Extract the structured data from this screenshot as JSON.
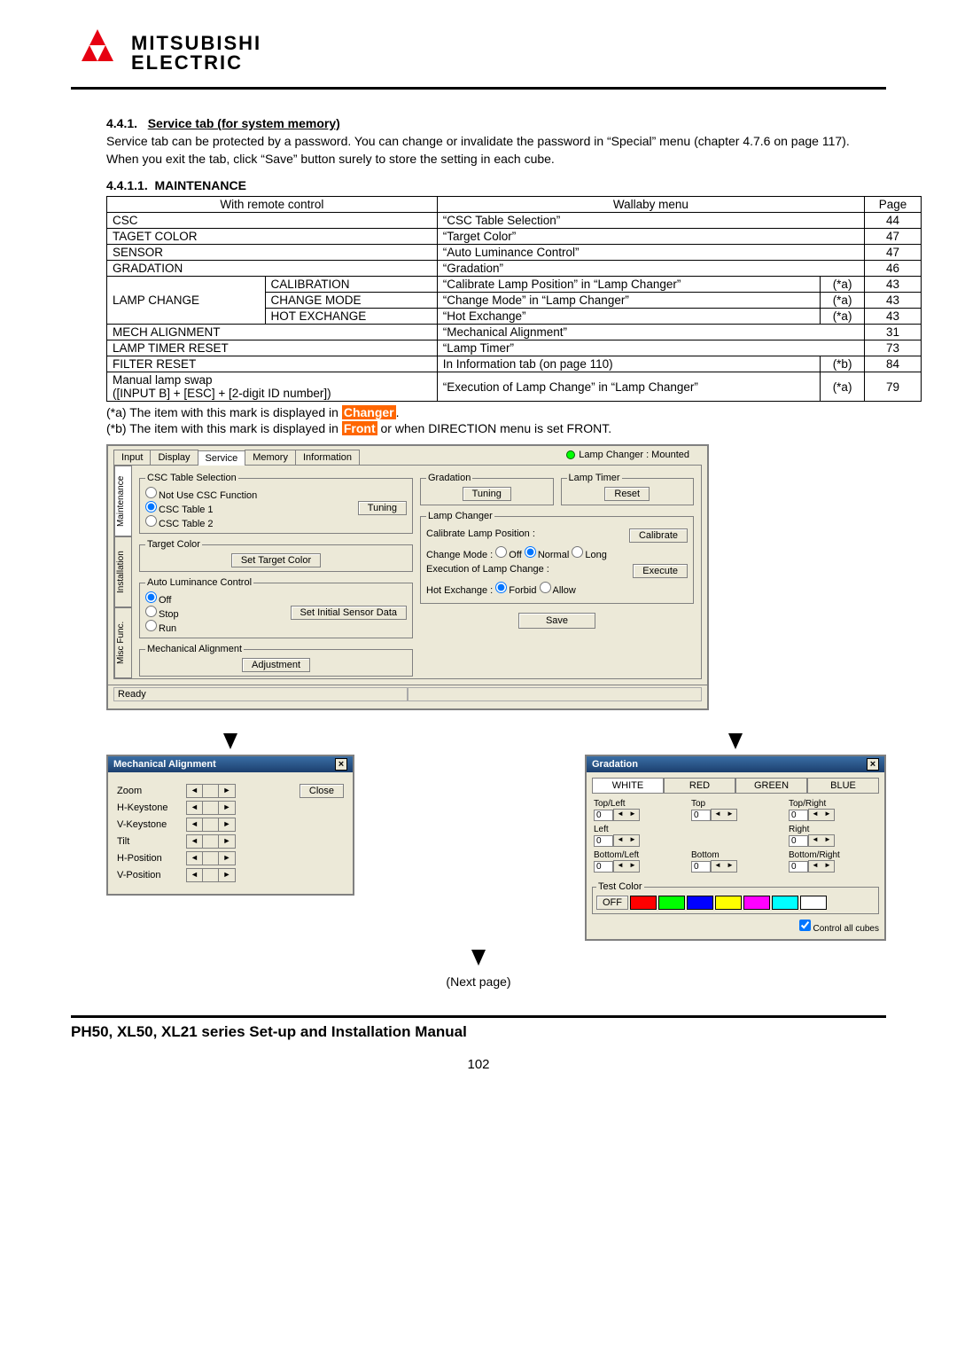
{
  "brand": {
    "line1": "MITSUBISHI",
    "line2": "ELECTRIC"
  },
  "section": {
    "num": "4.4.1.",
    "title": "Service tab (for system memory)",
    "p1": "Service tab can be protected by a password. You can change or invalidate the password in “Special” menu (chapter 4.7.6 on page 117).",
    "p2": "When you exit the tab, click “Save” button surely to store the setting in each cube."
  },
  "sub": {
    "num": "4.4.1.1.",
    "title": "MAINTENANCE"
  },
  "table": {
    "h1": "With remote control",
    "h2": "Wallaby menu",
    "h3": "Page",
    "rows": [
      {
        "c1": "CSC",
        "c2": "",
        "m": "“CSC Table Selection”",
        "f": "",
        "p": "44"
      },
      {
        "c1": "TAGET COLOR",
        "c2": "",
        "m": "“Target Color”",
        "f": "",
        "p": "47"
      },
      {
        "c1": "SENSOR",
        "c2": "",
        "m": "“Auto Luminance Control”",
        "f": "",
        "p": "47"
      },
      {
        "c1": "GRADATION",
        "c2": "",
        "m": "“Gradation”",
        "f": "",
        "p": "46"
      },
      {
        "c1": "LAMP CHANGE",
        "c2": "CALIBRATION",
        "m": "“Calibrate Lamp Position” in “Lamp Changer”",
        "f": "(*a)",
        "p": "43",
        "rs": 3
      },
      {
        "c2": "CHANGE MODE",
        "m": "“Change Mode” in “Lamp Changer”",
        "f": "(*a)",
        "p": "43"
      },
      {
        "c2": "HOT EXCHANGE",
        "m": "“Hot Exchange”",
        "f": "(*a)",
        "p": "43"
      },
      {
        "c1": "MECH ALIGNMENT",
        "c2": "",
        "m": "“Mechanical Alignment”",
        "f": "",
        "p": "31"
      },
      {
        "c1": "LAMP TIMER RESET",
        "c2": "",
        "m": "“Lamp Timer”",
        "f": "",
        "p": "73"
      },
      {
        "c1": "FILTER RESET",
        "c2": "",
        "m": "In Information tab (on page 110)",
        "f": "(*b)",
        "p": "84"
      },
      {
        "c1": "Manual lamp swap\n([INPUT B] + [ESC] + [2-digit ID number])",
        "c2": "",
        "m": "“Execution of Lamp Change” in “Lamp Changer”",
        "f": "(*a)",
        "p": "79"
      }
    ]
  },
  "notes": {
    "a_pre": "(*a) The item with this mark is displayed in ",
    "a_hl": "Changer",
    "a_post": ".",
    "b_pre": "(*b) The item with this mark is displayed in ",
    "b_hl": "Front",
    "b_post": " or when DIRECTION menu is set FRONT."
  },
  "dlg": {
    "tabs": [
      "Input",
      "Display",
      "Service",
      "Memory",
      "Information"
    ],
    "lamp_status": "Lamp Changer :  Mounted",
    "vtabs": [
      "Maintenance",
      "Installation",
      "Misc Func."
    ],
    "csc": {
      "legend": "CSC Table Selection",
      "opt0": "Not Use CSC Function",
      "opt1": "CSC Table 1",
      "opt2": "CSC Table 2",
      "tuning": "Tuning"
    },
    "target": {
      "legend": "Target Color",
      "btn": "Set Target Color"
    },
    "auto": {
      "legend": "Auto Luminance Control",
      "off": "Off",
      "stop": "Stop",
      "run": "Run",
      "btn": "Set Initial Sensor Data"
    },
    "mech": {
      "legend": "Mechanical Alignment",
      "btn": "Adjustment"
    },
    "grad": {
      "legend": "Gradation",
      "btn": "Tuning"
    },
    "lt": {
      "legend": "Lamp Timer",
      "btn": "Reset"
    },
    "lc": {
      "legend": "Lamp Changer",
      "calib_lbl": "Calibrate Lamp Position :",
      "calib_btn": "Calibrate",
      "cm_lbl": "Change Mode :",
      "cm_off": "Off",
      "cm_normal": "Normal",
      "cm_long": "Long",
      "exec_lbl": "Execution of Lamp Change :",
      "exec_btn": "Execute",
      "hot_lbl": "Hot Exchange :",
      "hot_forbid": "Forbid",
      "hot_allow": "Allow",
      "save": "Save"
    },
    "status": "Ready"
  },
  "mechdlg": {
    "title": "Mechanical Alignment",
    "close": "Close",
    "rows": [
      "Zoom",
      "H-Keystone",
      "V-Keystone",
      "Tilt",
      "H-Position",
      "V-Position"
    ]
  },
  "graddlg": {
    "title": "Gradation",
    "tabs": [
      "WHITE",
      "RED",
      "GREEN",
      "BLUE"
    ],
    "cells": {
      "tl": "Top/Left",
      "t": "Top",
      "tr": "Top/Right",
      "l": "Left",
      "r": "Right",
      "bl": "Bottom/Left",
      "b": "Bottom",
      "br": "Bottom/Right"
    },
    "val": "0",
    "testcolor": "Test Color",
    "off": "OFF",
    "colors": [
      "#ff0000",
      "#00ff00",
      "#0000ff",
      "#ffff00",
      "#ff00ff",
      "#00ffff",
      "#ffffff"
    ],
    "ctl": "Control all cubes"
  },
  "nextpage": "(Next page)",
  "footer": "PH50, XL50, XL21 series Set-up and Installation Manual",
  "pagenum": "102"
}
